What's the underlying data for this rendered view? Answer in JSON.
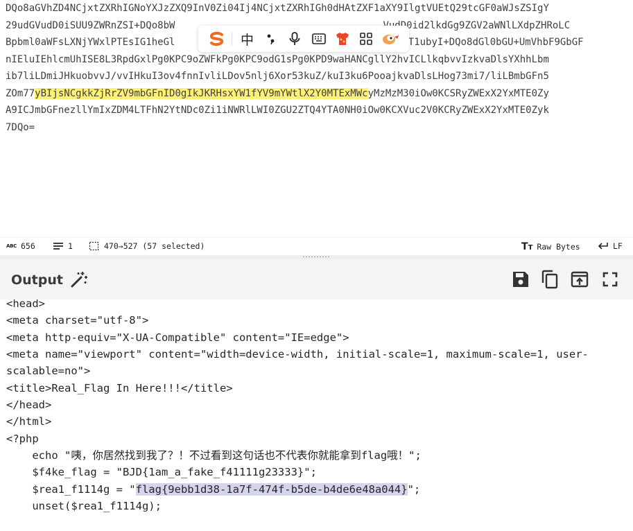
{
  "input": {
    "lines": [
      "DQo8aGVhZD4NCjxtZXRhIGNoYXJzZXQ9InV0Zi04Ij4NCjxtZXRhIGh0dHAtZXF1aXY9IlgtVUEtQ29tcGF0aWJsZSIgY",
      "29udGVudD0iSUU9ZWRnZSI+DQo8bW",
      "Bpbml0aWFsLXNjYWxlPTEsIG1heGl",
      "nIEluIEhlcmUhISE8L3RpdGxlPg0KPC9oZWFkPg0KPC9odG1sPg0KPD9waHANCgllY2hvICLlkqbvvIzkvaDlsYXhhLbm",
      "ib7liLDmiJHkuobvvJ/vvIHkuI3ov4fnnIvliLDov5nlj6Xor53kuZ/kuI3ku6PooajkvaDlsLHog73mi7/liLBmbGFn5",
      "yMzMzM30iOw0KCSRyZWExX2YxMTE0Zy",
      "A9ICJmbGFnezllYmIxZDM4LTFhN2YtNDc0Zi1iNWRlLWI0ZGU2ZTQ4YTA0NH0iOw0KCXVuc2V0KCRyZWExX2YxMTE0Zyk",
      "7DQo="
    ],
    "line2_tail": "VudD0id2lkdGg9ZGV2aWNlLXdpZHRoLC",
    "line3_tail": "sZT1ubyI+DQo8dGl0bGU+UmVhbF9GbGF",
    "line6_prefix": "ZOm77",
    "line6_highlight": "yBIjsNCgkkZjRrZV9mbGFnID0gIkJKRHsxYW1fYV9mYWtlX2Y0MTExMWc",
    "line3_mid": "g"
  },
  "ime_toolbar": {
    "logo_letter": "S",
    "lang_label": "中",
    "punct_label": "•,",
    "icons": [
      "mic-icon",
      "keyboard-icon",
      "shirt-icon",
      "apps-grid-icon",
      "mascot-icon"
    ]
  },
  "status": {
    "char_count": "656",
    "line_count": "1",
    "selection": "470→527 (57 selected)",
    "raw_bytes_label": "Raw Bytes",
    "eol_label": "LF"
  },
  "output": {
    "title": "Output",
    "lines": [
      "<head>",
      "<meta charset=\"utf-8\">",
      "<meta http-equiv=\"X-UA-Compatible\" content=\"IE=edge\">",
      "<meta name=\"viewport\" content=\"width=device-width, initial-scale=1, maximum-scale=1, user-",
      "scalable=no\">",
      "<title>Real_Flag In Here!!!</title>",
      "</head>",
      "</html>",
      "<?php",
      "    echo \"咦，你居然找到我了？！不过看到这句话也不代表你就能拿到flag哦！\";",
      "    $f4ke_flag = \"BJD{1am_a_fake_f41111g23333}\";",
      "    $rea1_f1114g = \"",
      "    unset($rea1_f1114g);"
    ],
    "flag_selected": "flag{9ebb1d38-1a7f-474f-b5de-b4de6e48a044}",
    "flag_line_end": "\";"
  },
  "colors": {
    "highlight": "#fff176",
    "selection": "#d4d4ec",
    "ime_logo": "#f26a1b",
    "header_bg": "#f4f4f4"
  }
}
